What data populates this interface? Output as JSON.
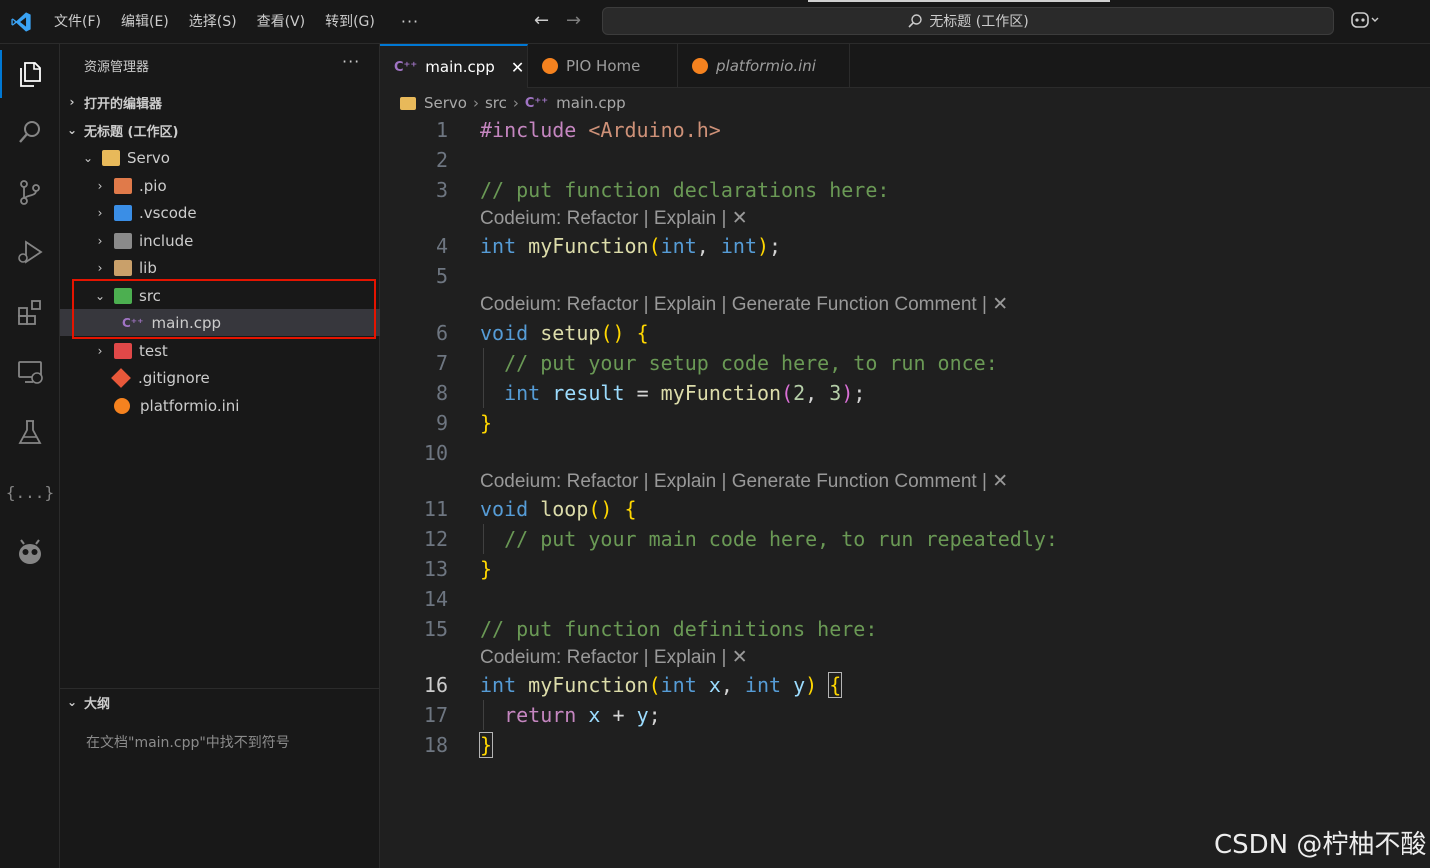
{
  "titlebar": {
    "menus": [
      "文件(F)",
      "编辑(E)",
      "选择(S)",
      "查看(V)",
      "转到(G)"
    ],
    "more": "···",
    "search_text": "无标题 (工作区)"
  },
  "activitybar": {
    "items": [
      "explorer-icon",
      "search-icon",
      "source-control-icon",
      "run-debug-icon",
      "extensions-icon",
      "remote-explorer-icon",
      "testing-icon",
      "json-icon",
      "platformio-icon"
    ]
  },
  "sidebar": {
    "title": "资源管理器",
    "more": "···",
    "open_editors": "打开的编辑器",
    "workspace": "无标题 (工作区)",
    "tree": [
      {
        "label": "Servo",
        "chevron": "⌄"
      },
      {
        "label": ".pio",
        "chevron": "›"
      },
      {
        "label": ".vscode",
        "chevron": "›"
      },
      {
        "label": "include",
        "chevron": "›"
      },
      {
        "label": "lib",
        "chevron": "›"
      },
      {
        "label": "src",
        "chevron": "⌄"
      },
      {
        "label": "main.cpp",
        "chevron": ""
      },
      {
        "label": "test",
        "chevron": "›"
      },
      {
        "label": ".gitignore",
        "chevron": ""
      },
      {
        "label": "platformio.ini",
        "chevron": ""
      }
    ],
    "outline_title": "大纲",
    "outline_message": "在文档\"main.cpp\"中找不到符号"
  },
  "editor": {
    "tabs": [
      {
        "label": "main.cpp",
        "icon": "C++",
        "active": true
      },
      {
        "label": "PIO Home",
        "icon": "pio",
        "active": false
      },
      {
        "label": "platformio.ini",
        "icon": "pio",
        "active": false
      }
    ],
    "tab_close": "✕",
    "breadcrumb": [
      "Servo",
      "src",
      "main.cpp"
    ],
    "lens_short": "Codeium: Refactor | Explain | ✕",
    "lens_long": "Codeium: Refactor | Explain | Generate Function Comment | ✕",
    "line_numbers": [
      "1",
      "2",
      "3",
      "4",
      "5",
      "6",
      "7",
      "8",
      "9",
      "10",
      "11",
      "12",
      "13",
      "14",
      "15",
      "16",
      "17",
      "18"
    ],
    "current_line": "16"
  },
  "watermark": "CSDN @柠柚不酸",
  "colors": {
    "accent": "#0078d4",
    "highlight_box": "#e51400",
    "keyword": "#569cd6",
    "comment": "#6a9955",
    "function": "#dcdcaa"
  }
}
